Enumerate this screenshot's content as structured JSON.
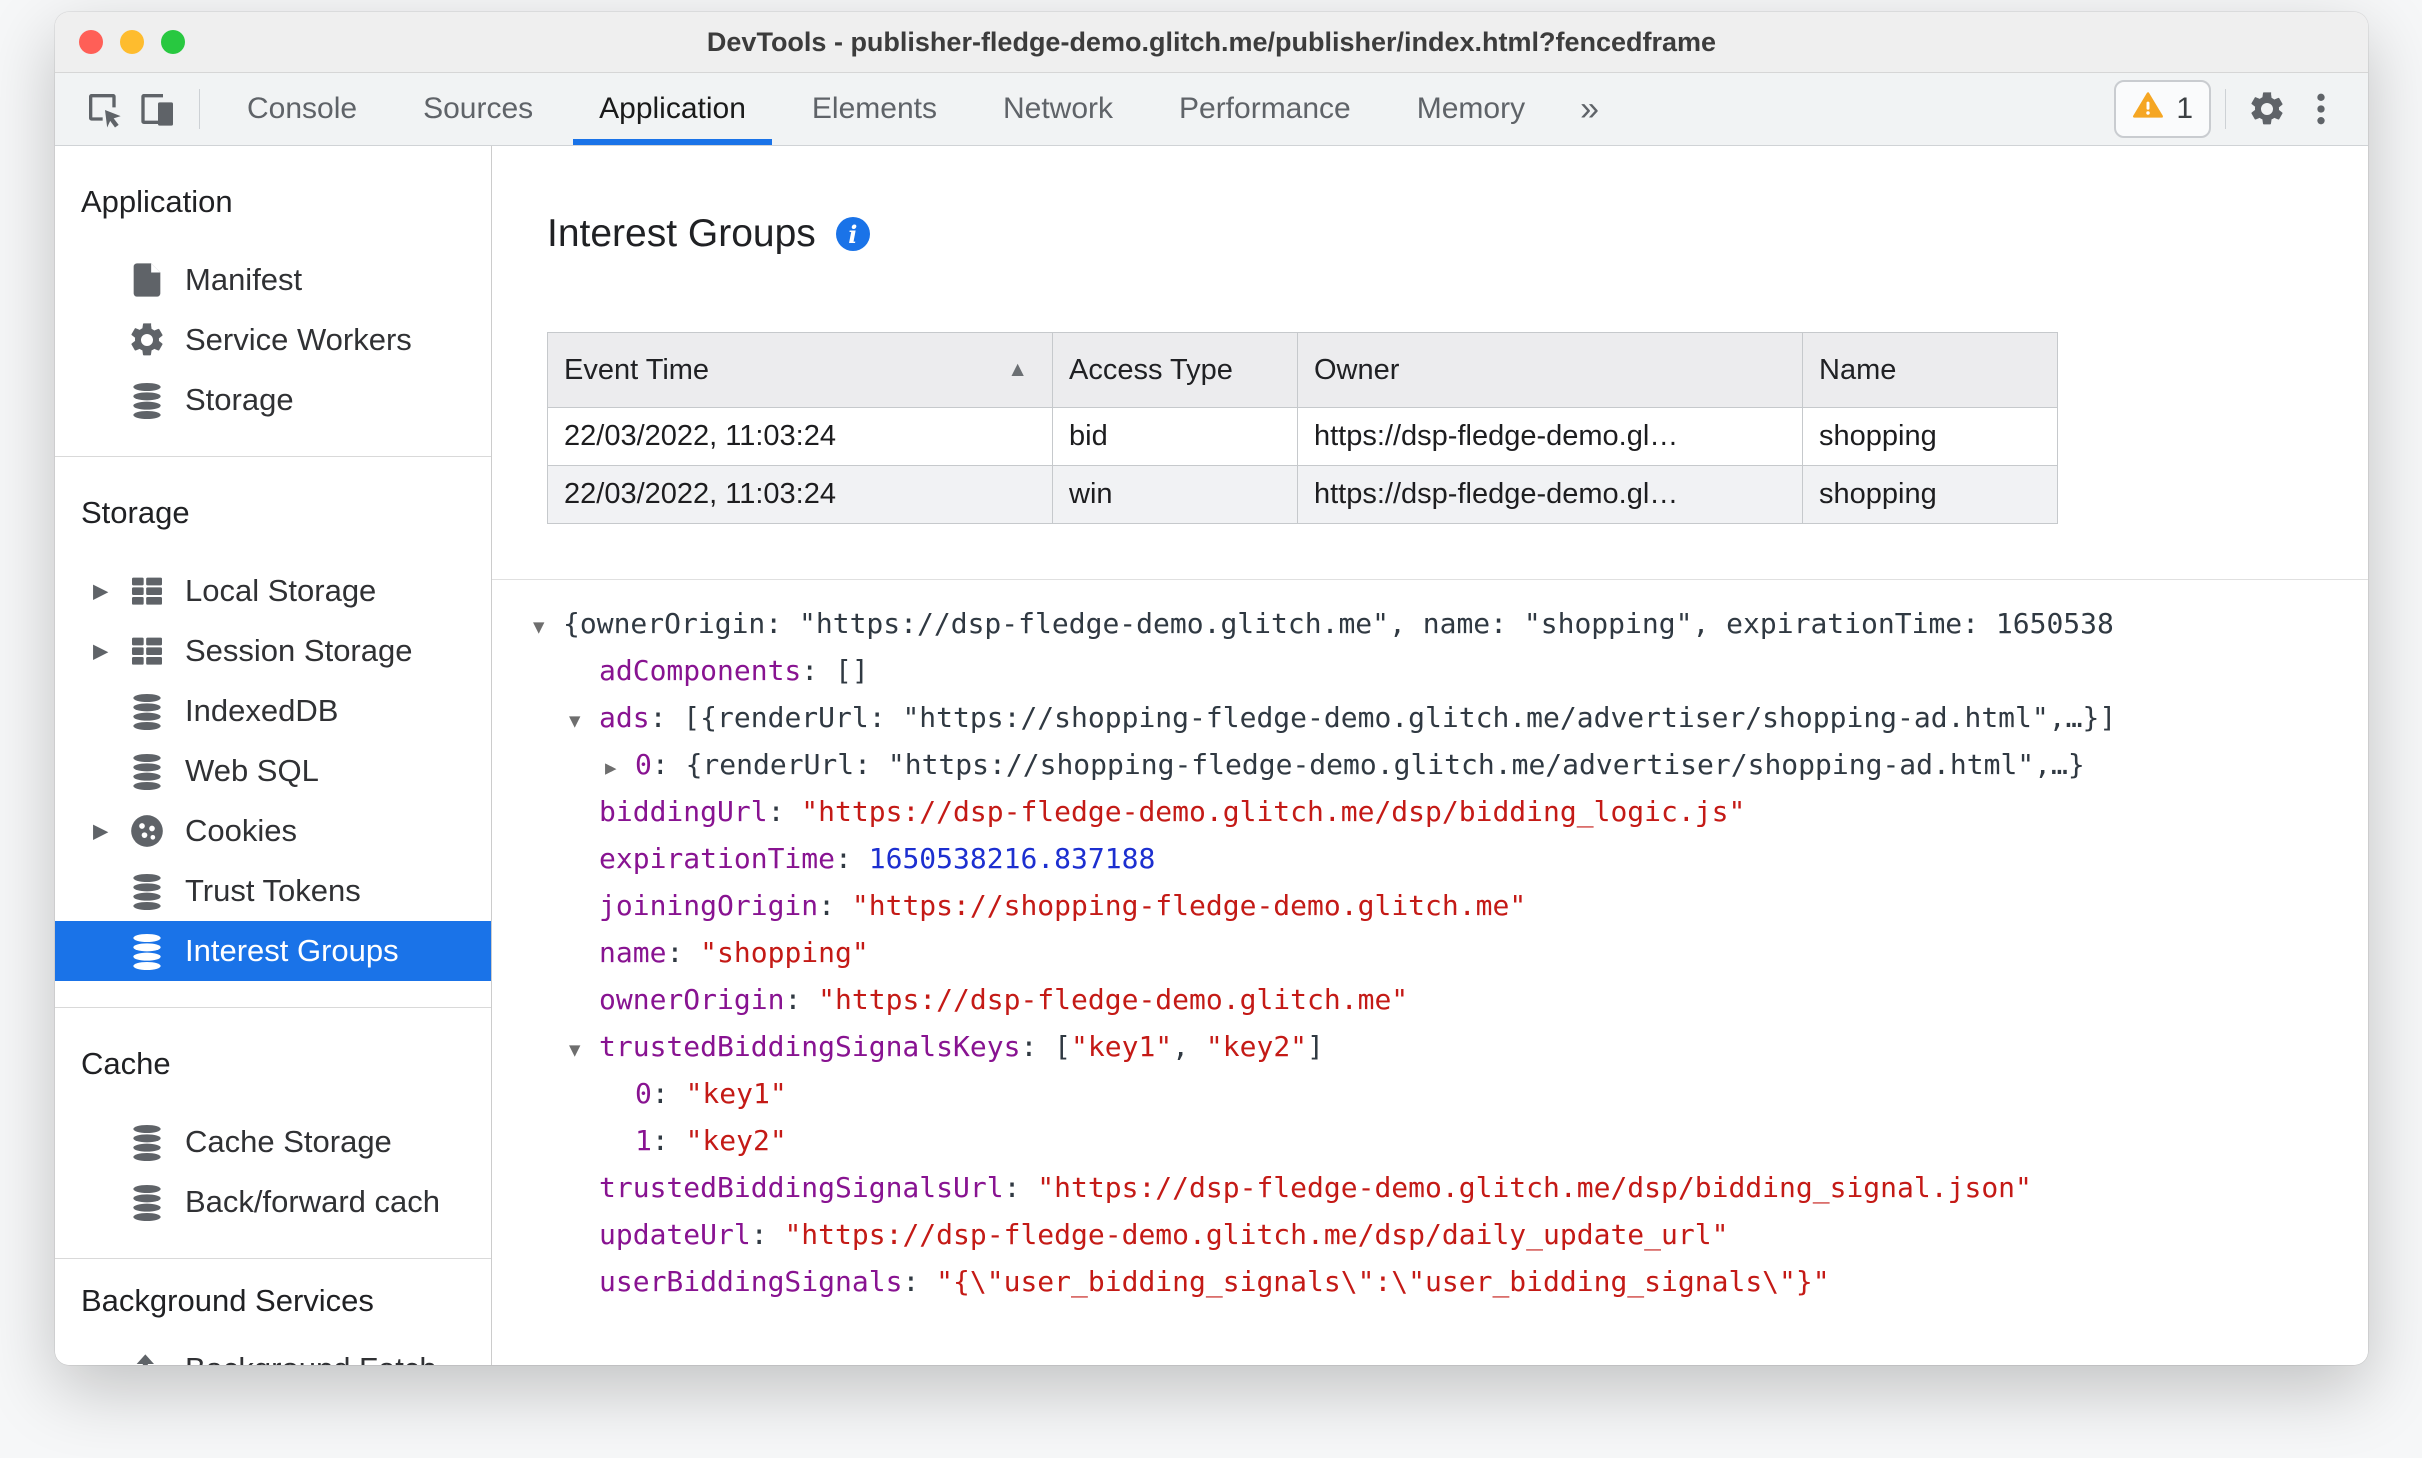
{
  "window": {
    "title": "DevTools - publisher-fledge-demo.glitch.me/publisher/index.html?fencedframe"
  },
  "toolbar": {
    "inspect_icon": "inspect-icon",
    "device_icon": "device-toolbar-icon",
    "tabs": [
      {
        "label": "Console",
        "active": false
      },
      {
        "label": "Sources",
        "active": false
      },
      {
        "label": "Application",
        "active": true
      },
      {
        "label": "Elements",
        "active": false
      },
      {
        "label": "Network",
        "active": false
      },
      {
        "label": "Performance",
        "active": false
      },
      {
        "label": "Memory",
        "active": false
      }
    ],
    "more_tabs": "»",
    "warning_count": "1",
    "settings_icon": "gear-icon",
    "menu_icon": "three-dot-menu-icon"
  },
  "sidebar": {
    "sections": [
      {
        "title": "Application",
        "items": [
          {
            "label": "Manifest",
            "icon": "manifest-file-icon"
          },
          {
            "label": "Service Workers",
            "icon": "service-worker-gear-icon"
          },
          {
            "label": "Storage",
            "icon": "database-icon"
          }
        ]
      },
      {
        "title": "Storage",
        "items": [
          {
            "label": "Local Storage",
            "icon": "table-icon",
            "expandable": true
          },
          {
            "label": "Session Storage",
            "icon": "table-icon",
            "expandable": true
          },
          {
            "label": "IndexedDB",
            "icon": "database-icon"
          },
          {
            "label": "Web SQL",
            "icon": "database-icon"
          },
          {
            "label": "Cookies",
            "icon": "cookie-icon",
            "expandable": true
          },
          {
            "label": "Trust Tokens",
            "icon": "database-icon"
          },
          {
            "label": "Interest Groups",
            "icon": "database-icon",
            "selected": true
          }
        ]
      },
      {
        "title": "Cache",
        "items": [
          {
            "label": "Cache Storage",
            "icon": "database-icon"
          },
          {
            "label": "Back/forward cach",
            "icon": "database-icon"
          }
        ]
      },
      {
        "title": "Background Services",
        "items": [
          {
            "label": "Background Fetch",
            "icon": "background-fetch-icon"
          }
        ]
      }
    ]
  },
  "main": {
    "heading": "Interest Groups",
    "info_icon": "info-icon",
    "table": {
      "columns": [
        "Event Time",
        "Access Type",
        "Owner",
        "Name"
      ],
      "sort_column": "Event Time",
      "sort_direction": "ascending",
      "rows": [
        [
          "22/03/2022, 11:03:24",
          "bid",
          "https://dsp-fledge-demo.gl…",
          "shopping"
        ],
        [
          "22/03/2022, 11:03:24",
          "win",
          "https://dsp-fledge-demo.gl…",
          "shopping"
        ]
      ]
    },
    "tree": [
      {
        "indent": 0,
        "arrow": "down",
        "segments": [
          {
            "t": "plain",
            "v": "{ownerOrigin: \"https://dsp-fledge-demo.glitch.me\", name: \"shopping\", expirationTime: 1650538"
          }
        ]
      },
      {
        "indent": 1,
        "arrow": "none",
        "segments": [
          {
            "t": "key",
            "v": "adComponents"
          },
          {
            "t": "plain",
            "v": ": []"
          }
        ]
      },
      {
        "indent": 1,
        "arrow": "down",
        "segments": [
          {
            "t": "key",
            "v": "ads"
          },
          {
            "t": "plain",
            "v": ": [{renderUrl: \"https://shopping-fledge-demo.glitch.me/advertiser/shopping-ad.html\",…}]"
          }
        ]
      },
      {
        "indent": 2,
        "arrow": "right",
        "segments": [
          {
            "t": "key",
            "v": "0"
          },
          {
            "t": "plain",
            "v": ": {renderUrl: \"https://shopping-fledge-demo.glitch.me/advertiser/shopping-ad.html\",…}"
          }
        ]
      },
      {
        "indent": 1,
        "arrow": "none",
        "segments": [
          {
            "t": "key",
            "v": "biddingUrl"
          },
          {
            "t": "plain",
            "v": ": "
          },
          {
            "t": "str",
            "v": "\"https://dsp-fledge-demo.glitch.me/dsp/bidding_logic.js\""
          }
        ]
      },
      {
        "indent": 1,
        "arrow": "none",
        "segments": [
          {
            "t": "key",
            "v": "expirationTime"
          },
          {
            "t": "plain",
            "v": ": "
          },
          {
            "t": "num",
            "v": "1650538216.837188"
          }
        ]
      },
      {
        "indent": 1,
        "arrow": "none",
        "segments": [
          {
            "t": "key",
            "v": "joiningOrigin"
          },
          {
            "t": "plain",
            "v": ": "
          },
          {
            "t": "str",
            "v": "\"https://shopping-fledge-demo.glitch.me\""
          }
        ]
      },
      {
        "indent": 1,
        "arrow": "none",
        "segments": [
          {
            "t": "key",
            "v": "name"
          },
          {
            "t": "plain",
            "v": ": "
          },
          {
            "t": "str",
            "v": "\"shopping\""
          }
        ]
      },
      {
        "indent": 1,
        "arrow": "none",
        "segments": [
          {
            "t": "key",
            "v": "ownerOrigin"
          },
          {
            "t": "plain",
            "v": ": "
          },
          {
            "t": "str",
            "v": "\"https://dsp-fledge-demo.glitch.me\""
          }
        ]
      },
      {
        "indent": 1,
        "arrow": "down",
        "segments": [
          {
            "t": "key",
            "v": "trustedBiddingSignalsKeys"
          },
          {
            "t": "plain",
            "v": ": ["
          },
          {
            "t": "str",
            "v": "\"key1\""
          },
          {
            "t": "plain",
            "v": ", "
          },
          {
            "t": "str",
            "v": "\"key2\""
          },
          {
            "t": "plain",
            "v": "]"
          }
        ]
      },
      {
        "indent": 2,
        "arrow": "none",
        "segments": [
          {
            "t": "key",
            "v": "0"
          },
          {
            "t": "plain",
            "v": ": "
          },
          {
            "t": "str",
            "v": "\"key1\""
          }
        ]
      },
      {
        "indent": 2,
        "arrow": "none",
        "segments": [
          {
            "t": "key",
            "v": "1"
          },
          {
            "t": "plain",
            "v": ": "
          },
          {
            "t": "str",
            "v": "\"key2\""
          }
        ]
      },
      {
        "indent": 1,
        "arrow": "none",
        "segments": [
          {
            "t": "key",
            "v": "trustedBiddingSignalsUrl"
          },
          {
            "t": "plain",
            "v": ": "
          },
          {
            "t": "str",
            "v": "\"https://dsp-fledge-demo.glitch.me/dsp/bidding_signal.json\""
          }
        ]
      },
      {
        "indent": 1,
        "arrow": "none",
        "segments": [
          {
            "t": "key",
            "v": "updateUrl"
          },
          {
            "t": "plain",
            "v": ": "
          },
          {
            "t": "str",
            "v": "\"https://dsp-fledge-demo.glitch.me/dsp/daily_update_url\""
          }
        ]
      },
      {
        "indent": 1,
        "arrow": "none",
        "segments": [
          {
            "t": "key",
            "v": "userBiddingSignals"
          },
          {
            "t": "plain",
            "v": ": "
          },
          {
            "t": "str",
            "v": "\"{\\\"user_bidding_signals\\\":\\\"user_bidding_signals\\\"}\""
          }
        ]
      }
    ]
  },
  "colors": {
    "accent": "#1a73e8",
    "selection": "#1a73e8",
    "syntax-key": "#881391",
    "syntax-string": "#c41a16",
    "syntax-number": "#1c2fd0",
    "warning": "#f5a623",
    "traffic-red": "#ff5f57",
    "traffic-yellow": "#febc2e",
    "traffic-green": "#28c840"
  }
}
